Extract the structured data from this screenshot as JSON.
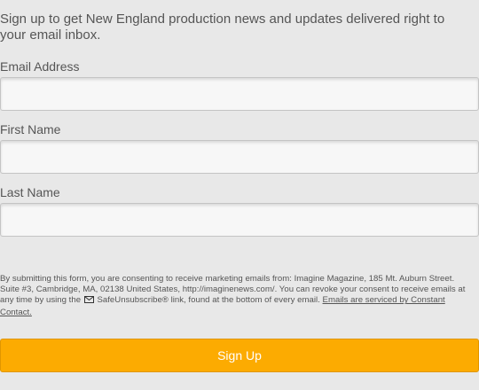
{
  "intro_text": "Sign up to get New England production news and updates delivered right to your email inbox.",
  "fields": {
    "email": {
      "label": "Email Address",
      "value": "",
      "placeholder": ""
    },
    "first_name": {
      "label": "First Name",
      "value": "",
      "placeholder": ""
    },
    "last_name": {
      "label": "Last Name",
      "value": "",
      "placeholder": ""
    }
  },
  "consent": {
    "text_before_icon": "By submitting this form, you are consenting to receive marketing emails from: Imagine Magazine, 185 Mt. Auburn Street. Suite #3, Cambridge, MA, 02138 United States, http://imaginenews.com/. You can revoke your consent to receive emails at any time by using the",
    "text_after_icon": "SafeUnsubscribe® link, found at the bottom of every email.",
    "link_text": "Emails are serviced by Constant Contact.",
    "icon": "envelope-icon"
  },
  "submit_label": "Sign Up",
  "colors": {
    "background": "#e8e8e8",
    "button": "#fcab01",
    "text": "#555555"
  }
}
